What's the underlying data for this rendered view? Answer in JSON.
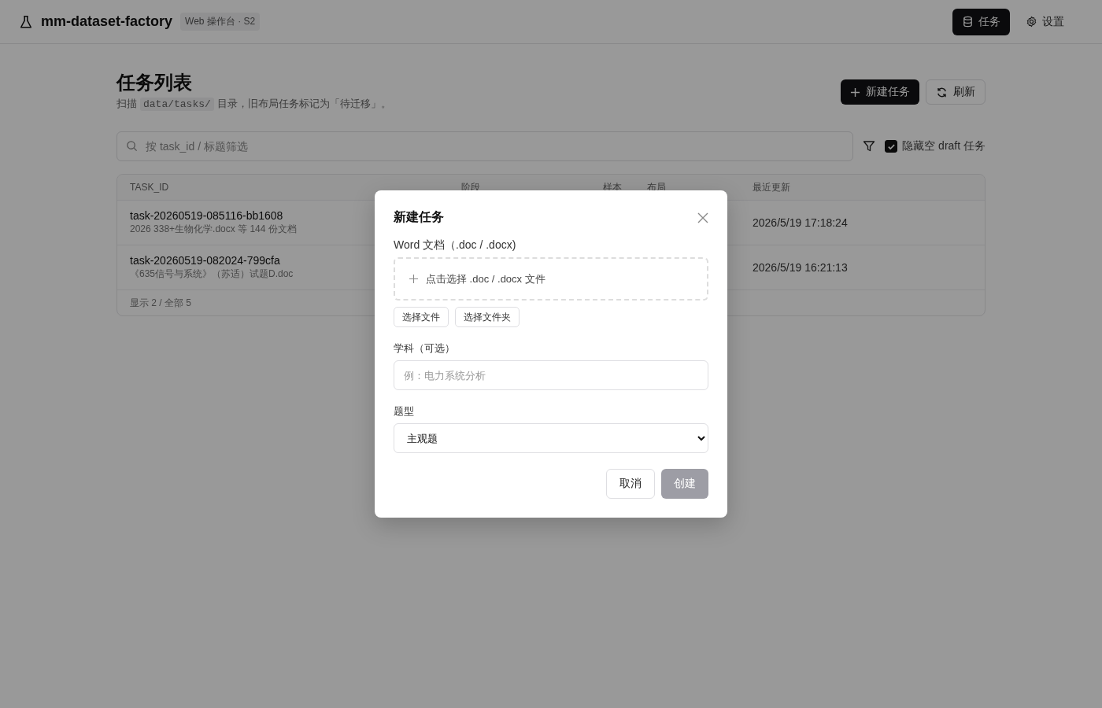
{
  "app": {
    "name": "mm-dataset-factory",
    "badge": "Web 操作台 · S2"
  },
  "nav": [
    {
      "label": "任务",
      "selected": true
    },
    {
      "label": "设置",
      "selected": false
    }
  ],
  "page": {
    "title": "任务列表",
    "description_before": "扫描",
    "description_code": "data/tasks/",
    "description_after": "目录，旧布局任务标记为「待迁移」。"
  },
  "actions": [
    {
      "kind": "primary",
      "label": "新建任务"
    },
    {
      "kind": "secondary",
      "label": "刷新"
    }
  ],
  "filter": {
    "placeholder": "按 task_id / 标题筛选",
    "hide_empty_draft": {
      "label": "隐藏空 draft 任务",
      "checked": true
    }
  },
  "table": {
    "columns": [
      "TASK_ID",
      "阶段",
      "样本",
      "布局",
      "最近更新"
    ],
    "rows": [
      {
        "task_id": "task-20260519-085116-bb1608",
        "subtitle": "2026 338+生物化学.docx 等 144 份文档",
        "updated": "2026/5/19 17:18:24"
      },
      {
        "task_id": "task-20260519-082024-799cfa",
        "subtitle": "《635信号与系统》（苏适）试题D.doc",
        "updated": "2026/5/19 16:21:13"
      }
    ],
    "footer": "显示 2 / 全部 5"
  },
  "dialog": {
    "title": "新建任务",
    "file_label": "Word 文档（.doc / .docx)",
    "dropzone_text": "点击选择 .doc / .docx 文件",
    "file_buttons": [
      "选择文件",
      "选择文件夹"
    ],
    "subject_label": "学科（可选）",
    "subject_placeholder": "例：电力系统分析",
    "type_label": "题型",
    "type_value": "主观题",
    "cancel": "取消",
    "create": {
      "label": "创建",
      "disabled": true
    }
  }
}
